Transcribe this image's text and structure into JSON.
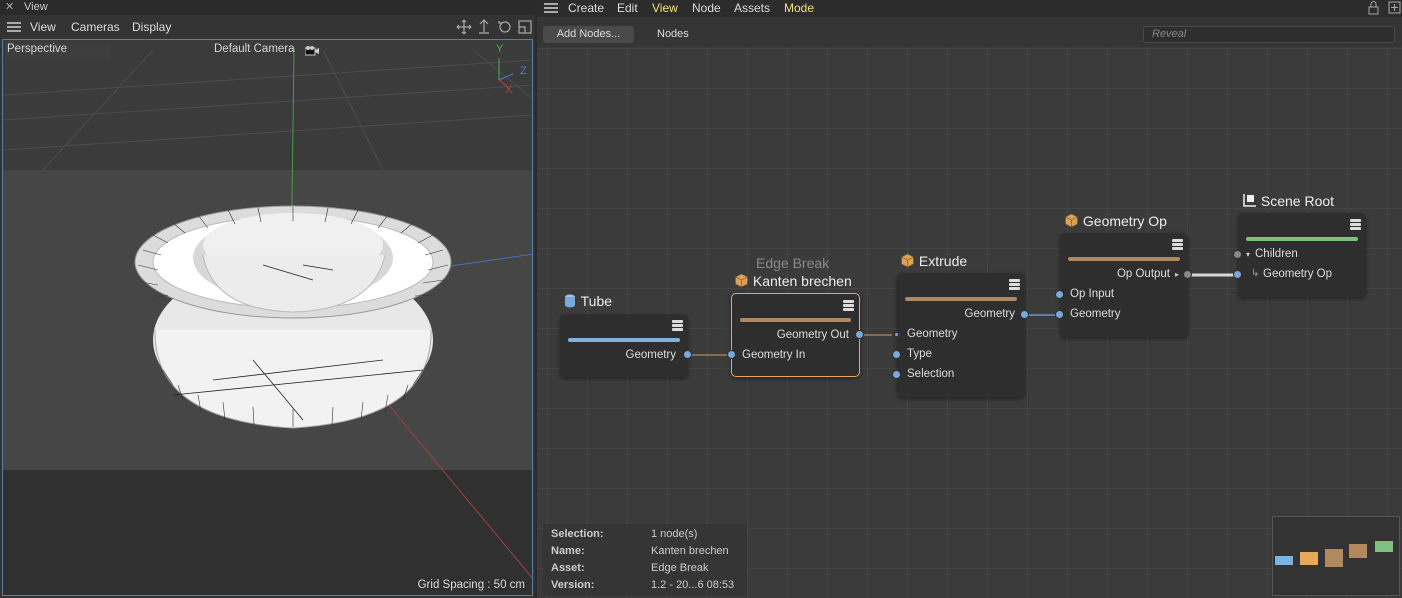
{
  "left_panel": {
    "title": "View",
    "menu": [
      "View",
      "Cameras",
      "Display"
    ],
    "viewport_label": "Perspective",
    "camera_label": "Default Camera",
    "axis_labels": {
      "y": "Y",
      "z": "Z",
      "x": "X"
    },
    "grid_spacing": "Grid Spacing : 50 cm"
  },
  "right_panel": {
    "menu": [
      "Create",
      "Edit",
      "View",
      "Node",
      "Assets",
      "Mode"
    ],
    "highlighted_menu": [
      "View",
      "Mode"
    ],
    "add_nodes_label": "Add Nodes...",
    "nodes_tab": "Nodes",
    "reveal_placeholder": "Reveal"
  },
  "nodes": {
    "tube": {
      "title": "Tube",
      "out_port": "Geometry",
      "bar_color": "#7fb2dc"
    },
    "edge_break": {
      "subtitle": "Edge Break",
      "title": "Kanten brechen",
      "out_port": "Geometry Out",
      "in_port": "Geometry In",
      "bar_color": "#b08a5e"
    },
    "extrude": {
      "title": "Extrude",
      "out_port": "Geometry",
      "in_ports": [
        "Geometry",
        "Type",
        "Selection"
      ],
      "bar_color": "#b08a5e"
    },
    "geometry_op": {
      "title": "Geometry Op",
      "out_port": "Op Output",
      "in_ports": [
        "Op Input",
        "Geometry"
      ],
      "bar_color": "#b08a5e"
    },
    "scene_root": {
      "title": "Scene Root",
      "children_label": "Children",
      "child_port": "Geometry Op",
      "bar_color": "#7fbf7f"
    }
  },
  "info": {
    "rows": [
      {
        "key": "Selection:",
        "value": "1 node(s)"
      },
      {
        "key": "Name:",
        "value": "Kanten brechen"
      },
      {
        "key": "Asset:",
        "value": "Edge Break"
      },
      {
        "key": "Version:",
        "value": "1.2 - 20...6 08:53"
      }
    ]
  },
  "colors": {
    "accent_yellow": "#f3e37a",
    "selection_orange": "#e7a85b",
    "port_blue": "#7aa8dc"
  }
}
